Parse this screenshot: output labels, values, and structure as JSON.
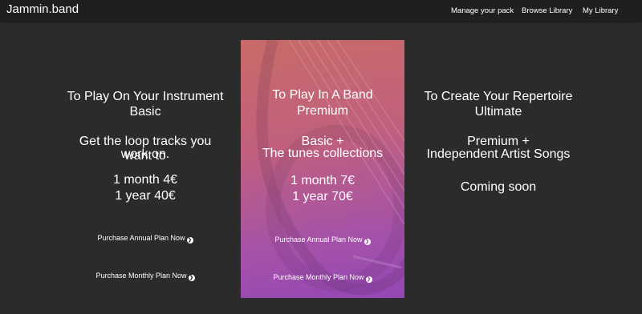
{
  "brand": "Jammin.band",
  "nav": {
    "manage": "Manage your pack",
    "browse": "Browse Library",
    "library": "My Library"
  },
  "plans": {
    "basic": {
      "kicker": "To Play On Your Instrument",
      "name": "Basic",
      "desc1": "Get the loop tracks you want to",
      "desc2": "work on.",
      "price_month": "1 month 4€",
      "price_year": "1 year 40€",
      "annual_link": "Purchase Annual Plan Now",
      "monthly_link": "Purchase Monthly Plan Now"
    },
    "premium": {
      "kicker": "To Play In A Band",
      "name": "Premium",
      "desc1": "Basic +",
      "desc2": "The tunes collections",
      "price_month": "1 month 7€",
      "price_year": "1 year 70€",
      "annual_link": "Purchase Annual Plan Now",
      "monthly_link": "Purchase Monthly Plan Now"
    },
    "ultimate": {
      "kicker": "To Create Your Repertoire",
      "name": "Ultimate",
      "desc1": "Premium +",
      "desc2": "Independent Artist Songs",
      "status": "Coming soon"
    }
  },
  "icons": {
    "link_arrow": "chevron-right-circle-icon"
  }
}
